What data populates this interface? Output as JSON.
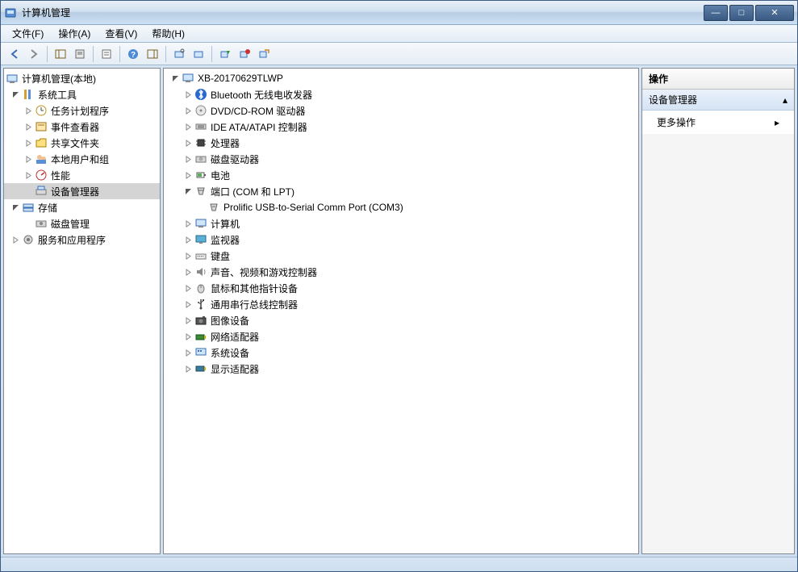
{
  "window": {
    "title": "计算机管理"
  },
  "menus": {
    "file": "文件(F)",
    "action": "操作(A)",
    "view": "查看(V)",
    "help": "帮助(H)"
  },
  "left_tree": {
    "root": "计算机管理(本地)",
    "system_tools": "系统工具",
    "task_scheduler": "任务计划程序",
    "event_viewer": "事件查看器",
    "shared_folders": "共享文件夹",
    "local_users": "本地用户和组",
    "performance": "性能",
    "device_manager": "设备管理器",
    "storage": "存储",
    "disk_management": "磁盘管理",
    "services_apps": "服务和应用程序"
  },
  "center_tree": {
    "computer": "XB-20170629TLWP",
    "bluetooth": "Bluetooth 无线电收发器",
    "dvd": "DVD/CD-ROM 驱动器",
    "ide": "IDE ATA/ATAPI 控制器",
    "processors": "处理器",
    "disk_drives": "磁盘驱动器",
    "battery": "电池",
    "ports": "端口 (COM 和 LPT)",
    "port_item": "Prolific USB-to-Serial Comm Port (COM3)",
    "computers": "计算机",
    "monitors": "监视器",
    "keyboards": "键盘",
    "sound": "声音、视频和游戏控制器",
    "mice": "鼠标和其他指针设备",
    "usb": "通用串行总线控制器",
    "imaging": "图像设备",
    "network": "网络适配器",
    "system_devices": "系统设备",
    "display": "显示适配器"
  },
  "right": {
    "header": "操作",
    "section": "设备管理器",
    "more_actions": "更多操作"
  }
}
